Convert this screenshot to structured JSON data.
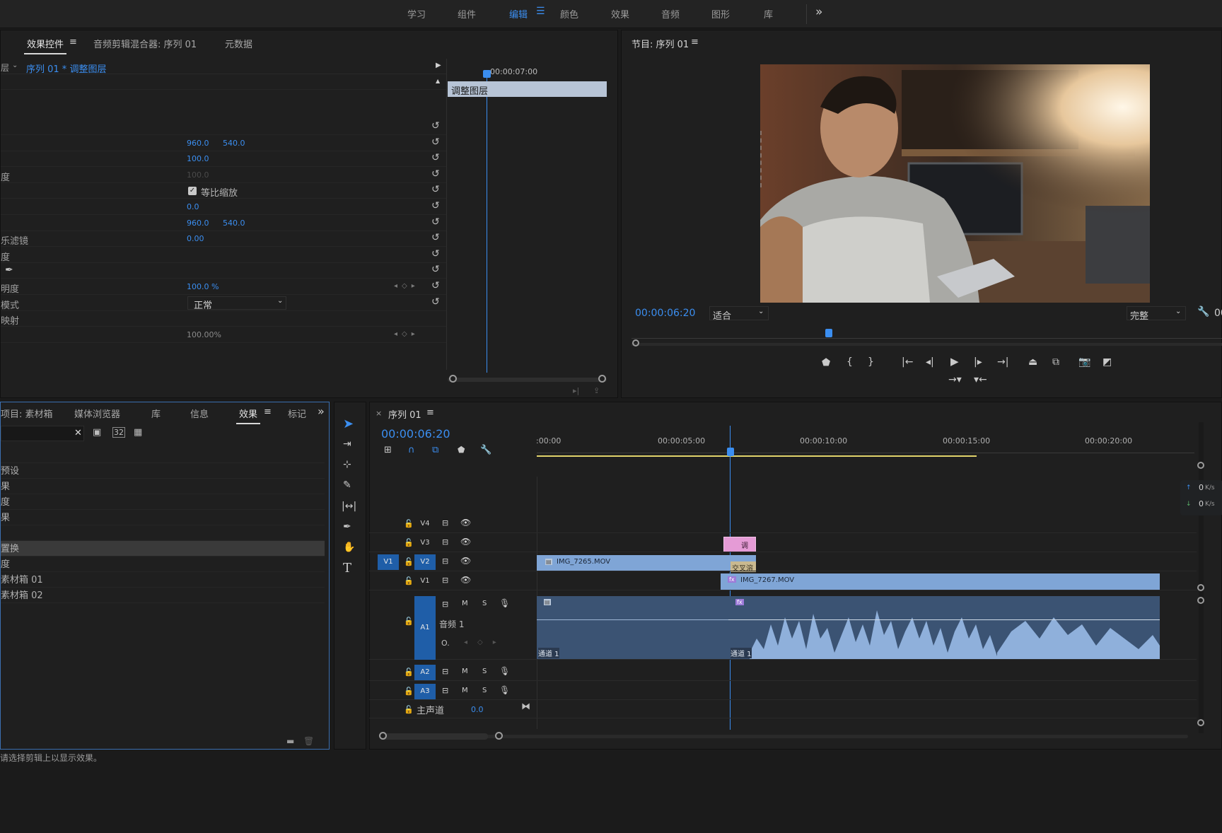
{
  "workspaces": [
    "学习",
    "组件",
    "编辑",
    "颜色",
    "效果",
    "音频",
    "图形",
    "库"
  ],
  "workspace_active": "编辑",
  "workspace_more": "»",
  "effect_controls": {
    "tabs": [
      "效果控件",
      "音频剪辑混合器: 序列 01",
      "元数据"
    ],
    "source_prefix": "层",
    "clip_path": "序列 01 * 调整图层",
    "mini_timecode": "00:00:07:00",
    "mini_clip_label": "调整图层",
    "rows": [
      {
        "label": "",
        "v1": "",
        "v2": ""
      },
      {
        "label": "",
        "v1": "960.0",
        "v2": "540.0"
      },
      {
        "label": "",
        "v1": "100.0",
        "v2": ""
      },
      {
        "label": "度",
        "v1": "100.0",
        "v2": ""
      },
      {
        "label": "",
        "checkbox": "等比缩放"
      },
      {
        "label": "",
        "v1": "0.0",
        "v2": ""
      },
      {
        "label": "",
        "v1": "960.0",
        "v2": "540.0"
      },
      {
        "label": "乐滤镜",
        "v1": "0.00",
        "v2": ""
      },
      {
        "label": "度",
        "v1": "",
        "v2": ""
      },
      {
        "label": "",
        "pen": true
      },
      {
        "label": "明度",
        "v1": "100.0 %",
        "v2": ""
      },
      {
        "label": "模式",
        "dropdown": "正常"
      },
      {
        "label": "映射",
        "v1": "",
        "v2": ""
      },
      {
        "label": "",
        "v1": "100.00%",
        "v2": ""
      }
    ]
  },
  "program": {
    "title": "节目: 序列 01",
    "timecode": "00:00:06:20",
    "fit_label": "适合",
    "quality_label": "完整",
    "right_edge": "00"
  },
  "effects_panel": {
    "tabs": [
      "项目: 素材箱",
      "媒体浏览器",
      "库",
      "信息",
      "效果",
      "标记"
    ],
    "search_value": "",
    "items": [
      "",
      "预设",
      "果",
      "度",
      "果",
      "",
      "置换",
      "度",
      "素材箱 01",
      "素材箱 02"
    ],
    "status_text": "请选择剪辑上以显示效果。"
  },
  "timeline": {
    "title": "序列 01",
    "timecode": "00:00:06:20",
    "ruler": [
      ":00:00",
      "00:00:05:00",
      "00:00:10:00",
      "00:00:15:00",
      "00:00:20:00"
    ],
    "video_tracks": [
      "V4",
      "V3",
      "V2",
      "V1"
    ],
    "source_patch": "V1",
    "audio_tracks": [
      "A1",
      "A2",
      "A3"
    ],
    "a1_name": "音频 1",
    "master_label": "主声道",
    "master_value": "0.0",
    "clips": {
      "v3_label": "调",
      "v2_label": "IMG_7265.MOV",
      "transition_label": "交叉溶",
      "v1_label": "IMG_7267.MOV",
      "a1_left_label": "通道 1",
      "a1_right_label": "通道 1"
    },
    "m": "M",
    "s": "S",
    "speed_up": "0",
    "speed_down": "0",
    "speed_unit": "K/s"
  }
}
